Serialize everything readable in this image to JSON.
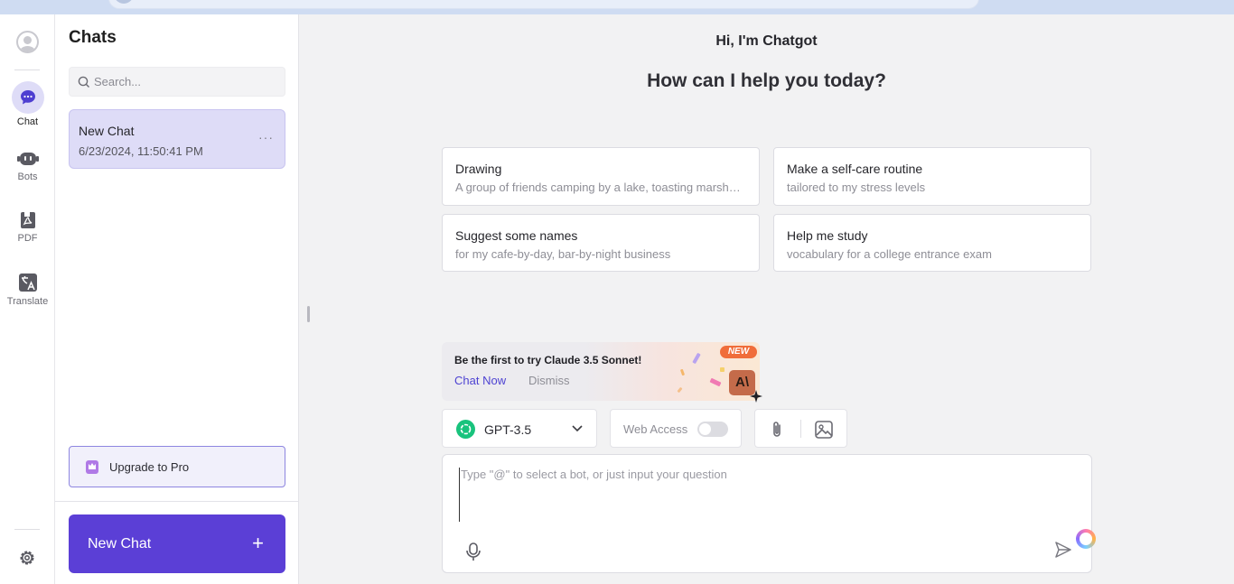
{
  "rail": {
    "items": [
      {
        "label": "Chat",
        "icon": "chat-icon"
      },
      {
        "label": "Bots",
        "icon": "bot-icon"
      },
      {
        "label": "PDF",
        "icon": "pdf-icon"
      },
      {
        "label": "Translate",
        "icon": "translate-icon"
      }
    ],
    "settings_icon": "gear-icon"
  },
  "sidebar": {
    "title": "Chats",
    "search_placeholder": "Search...",
    "chats": [
      {
        "title": "New Chat",
        "date": "6/23/2024, 11:50:41 PM"
      }
    ],
    "more_label": "···",
    "upgrade_label": "Upgrade to Pro",
    "new_chat_label": "New Chat",
    "new_chat_plus": "+"
  },
  "main": {
    "greeting": "Hi, I'm Chatgot",
    "headline": "How can I help you today?",
    "suggestions": [
      {
        "title": "Drawing",
        "subtitle": "A group of friends camping by a lake, toasting marshmallows"
      },
      {
        "title": "Make a self-care routine",
        "subtitle": "tailored to my stress levels"
      },
      {
        "title": "Suggest some names",
        "subtitle": "for my cafe-by-day, bar-by-night business"
      },
      {
        "title": "Help me study",
        "subtitle": "vocabulary for a college entrance exam"
      }
    ],
    "promo": {
      "title": "Be the first to try Claude 3.5 Sonnet!",
      "chat_now": "Chat Now",
      "dismiss": "Dismiss",
      "badge": "NEW",
      "logo_text": "A\\"
    },
    "model": {
      "label": "GPT-3.5"
    },
    "web_access": {
      "label": "Web Access",
      "enabled": false
    },
    "composer": {
      "placeholder": "Type \"@\" to select a bot, or just input your question"
    }
  },
  "colors": {
    "accent": "#5b3fd6",
    "active_bg": "#dedcf7",
    "link": "#4e43d2",
    "new_badge": "#f06d3a",
    "gpt_green": "#19c37d"
  }
}
